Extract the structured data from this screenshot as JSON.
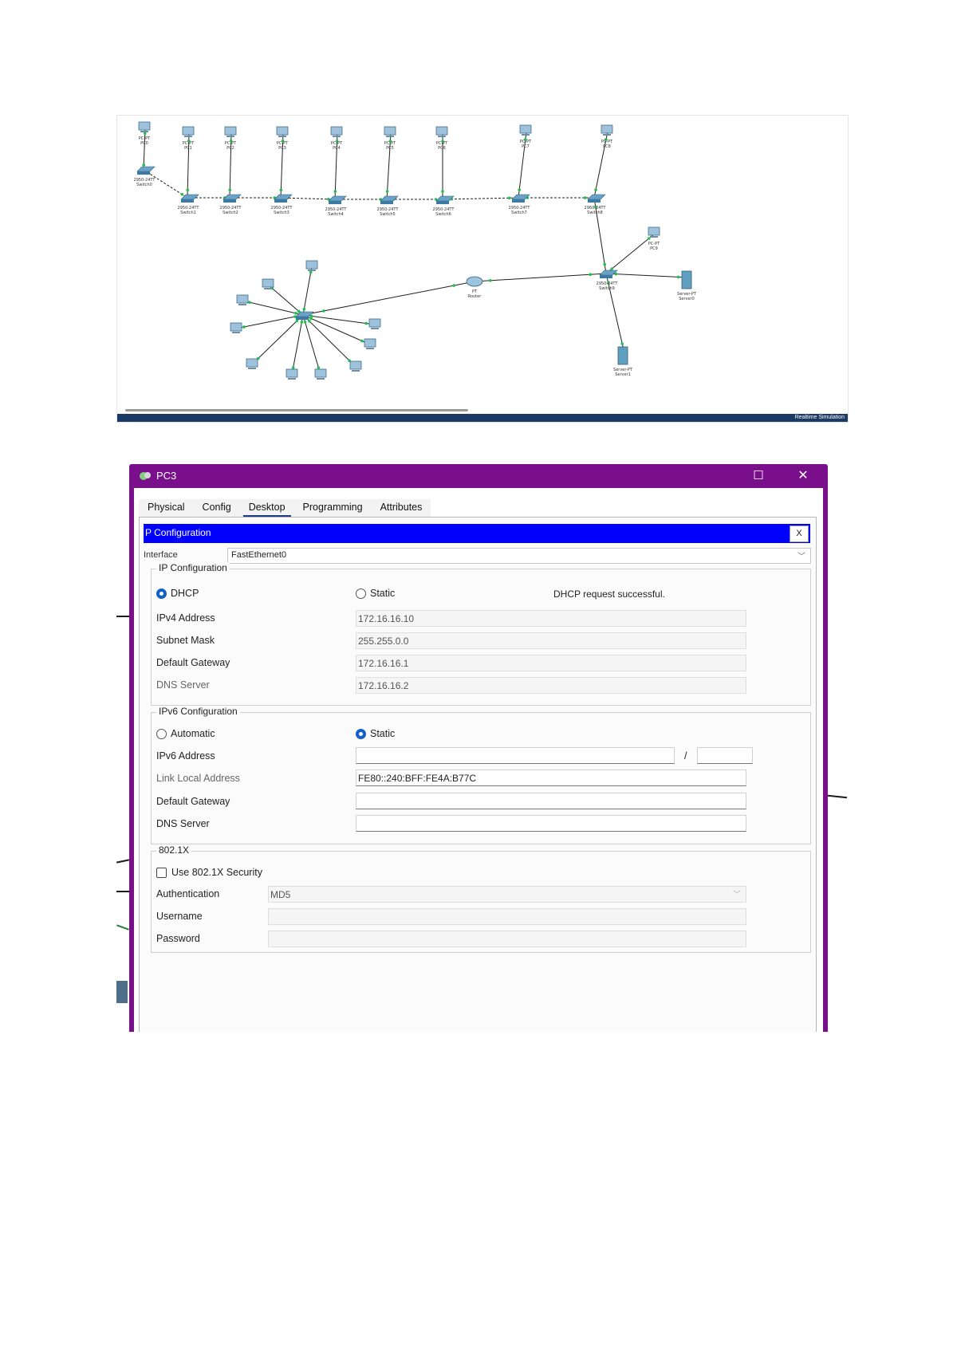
{
  "topology": {
    "devices": [
      {
        "name": "PC-PT",
        "label": "PC0"
      },
      {
        "name": "PC-PT",
        "label": "PC1"
      },
      {
        "name": "PC-PT",
        "label": "PC2"
      },
      {
        "name": "PC-PT",
        "label": "PC3"
      },
      {
        "name": "PC-PT",
        "label": "PC4"
      },
      {
        "name": "PC-PT",
        "label": "PC5"
      },
      {
        "name": "PC-PT",
        "label": "PC6"
      },
      {
        "name": "PC-PT",
        "label": "PC7"
      },
      {
        "name": "PC-PT",
        "label": "PC8"
      },
      {
        "name": "2950-24TT",
        "label": "Switch0"
      },
      {
        "name": "2950-24TT",
        "label": "Switch1"
      },
      {
        "name": "2950-24TT",
        "label": "Switch2"
      },
      {
        "name": "2950-24TT",
        "label": "Switch3"
      },
      {
        "name": "2950-24TT",
        "label": "Switch4"
      },
      {
        "name": "2950-24TT",
        "label": "Switch5"
      },
      {
        "name": "2950-24TT",
        "label": "Switch6"
      },
      {
        "name": "2950-24TT",
        "label": "Switch7"
      },
      {
        "name": "2960-24TT",
        "label": "Switch8"
      },
      {
        "name": "PC-PT",
        "label": "PC9"
      },
      {
        "name": "Server-PT",
        "label": "Server0"
      },
      {
        "name": "Server-PT",
        "label": "Server1"
      },
      {
        "name": "PT",
        "label": "Router"
      },
      {
        "name": "2950-24TT",
        "label": "Switch9"
      }
    ],
    "status_right": "Realtime  Simulation"
  },
  "window": {
    "title": "PC3",
    "maximize_glyph": "☐",
    "close_glyph": "✕",
    "tabs": [
      "Physical",
      "Config",
      "Desktop",
      "Programming",
      "Attributes"
    ],
    "active_tab": "Desktop"
  },
  "ip_config": {
    "header": "P Configuration",
    "close_label": "X",
    "interface_label": "Interface",
    "interface_value": "FastEthernet0",
    "ipv4": {
      "legend": "IP Configuration",
      "dhcp_label": "DHCP",
      "static_label": "Static",
      "mode": "DHCP",
      "status_message": "DHCP request successful.",
      "fields": [
        {
          "label": "IPv4 Address",
          "value": "172.16.16.10"
        },
        {
          "label": "Subnet Mask",
          "value": "255.255.0.0"
        },
        {
          "label": "Default Gateway",
          "value": "172.16.16.1"
        },
        {
          "label": "DNS Server",
          "value": "172.16.16.2"
        }
      ]
    },
    "ipv6": {
      "legend": "IPv6 Configuration",
      "auto_label": "Automatic",
      "static_label": "Static",
      "mode": "Static",
      "prefix_separator": "/",
      "fields": [
        {
          "label": "IPv6 Address",
          "value": ""
        },
        {
          "label": "Link Local Address",
          "value": "FE80::240:BFF:FE4A:B77C"
        },
        {
          "label": "Default Gateway",
          "value": ""
        },
        {
          "label": "DNS Server",
          "value": ""
        }
      ]
    },
    "dot1x": {
      "legend": "802.1X",
      "use_label": "Use 802.1X Security",
      "checked": false,
      "auth_label": "Authentication",
      "auth_value": "MD5",
      "username_label": "Username",
      "password_label": "Password"
    }
  },
  "colors": {
    "title_bar": "#7a0f8c",
    "ip_header": "#0000ff",
    "link": "#1f1f1f",
    "link_dot": "#22c04a"
  }
}
